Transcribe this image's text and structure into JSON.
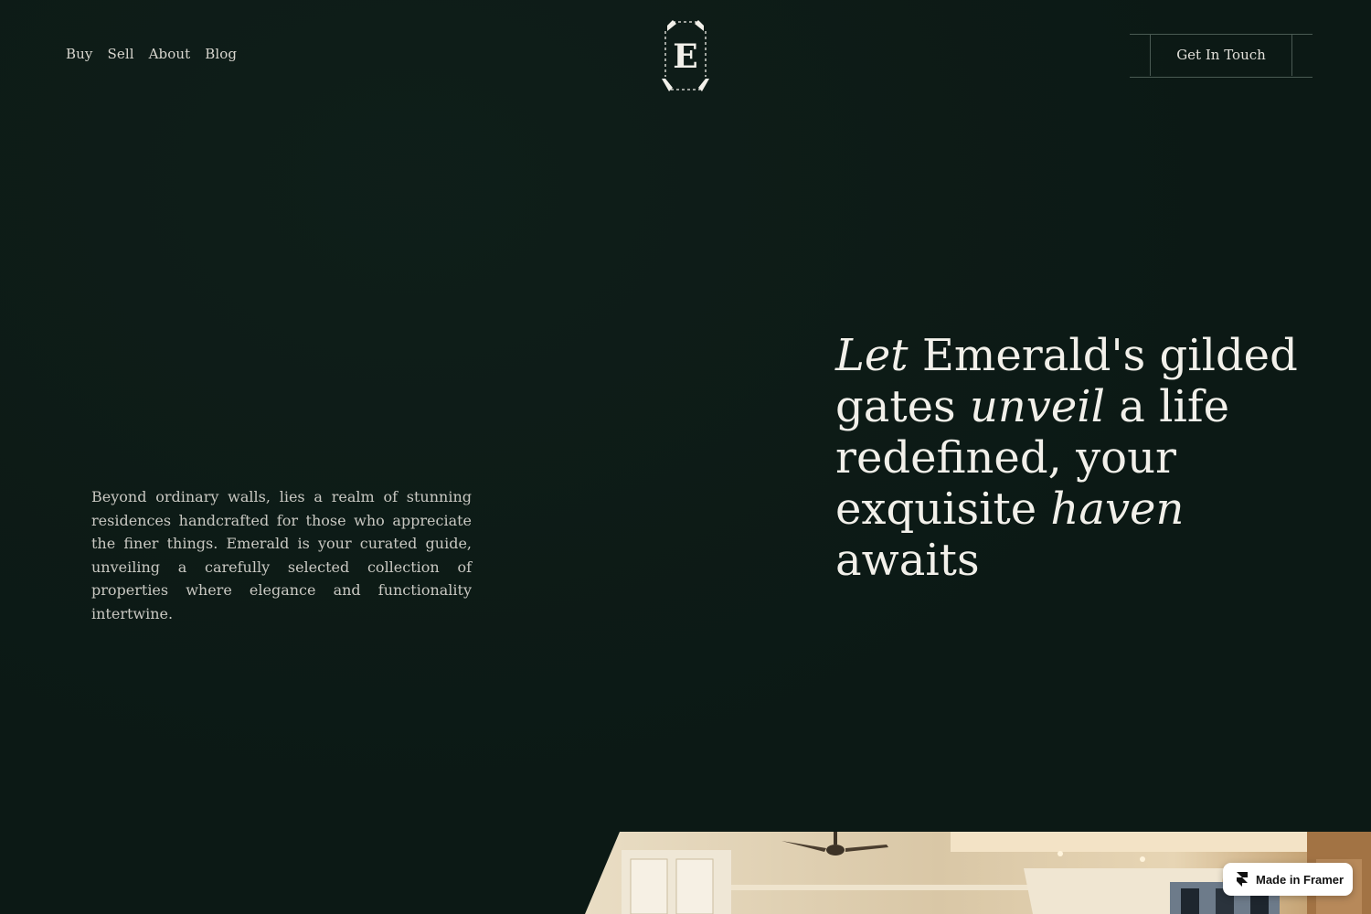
{
  "nav": {
    "items": [
      {
        "label": "Buy"
      },
      {
        "label": "Sell"
      },
      {
        "label": "About"
      },
      {
        "label": "Blog"
      }
    ]
  },
  "logo": {
    "letter": "E",
    "icon": "emerald-crest-logo"
  },
  "cta": {
    "label": "Get In Touch"
  },
  "hero": {
    "intro": "Beyond ordinary walls, lies a realm of stunning residences handcrafted for those who appreciate the finer things. Emerald is your curated guide, unveiling a carefully selected collection of properties where elegance and functionality intertwine.",
    "headline": {
      "part1_italic": "Let",
      "part2": " Emerald's gilded gates ",
      "part3_italic": "unveil",
      "part4": " a life redefined, your exquisite ",
      "part5_italic": "haven",
      "part6": " awaits"
    }
  },
  "badge": {
    "label": "Made in Framer",
    "icon": "framer-icon"
  },
  "colors": {
    "background": "#0c1915",
    "text": "#f2f0ea",
    "muted_text": "#c9c8c2",
    "border": "#4a5a53",
    "badge_bg": "#ffffff"
  }
}
